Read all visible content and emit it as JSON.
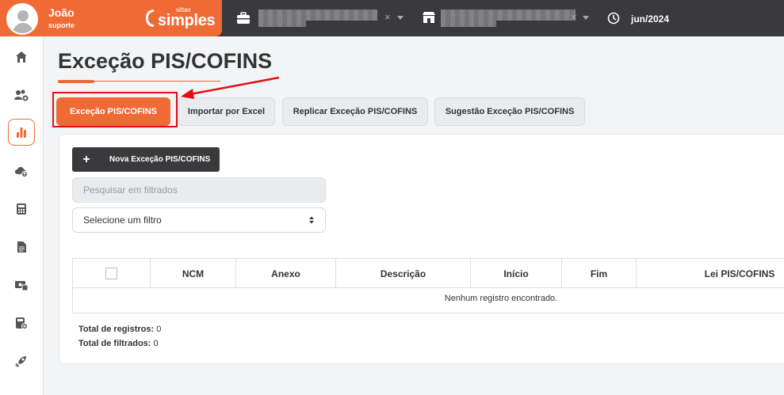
{
  "header": {
    "user_name": "João",
    "user_role": "suporte",
    "logo_small": "sittax",
    "logo_big": "simples",
    "company_icon": "briefcase-icon",
    "store_icon": "store-icon",
    "clock_icon": "clock-icon",
    "period": "jun/2024",
    "colors": {
      "brand": "#f06a35",
      "bar": "#3a3a3c"
    }
  },
  "sidebar": {
    "items": [
      {
        "icon": "home-icon"
      },
      {
        "icon": "users-add-icon"
      },
      {
        "icon": "bar-chart-icon",
        "active": true
      },
      {
        "icon": "cloud-upload-icon"
      },
      {
        "icon": "calculator-icon"
      },
      {
        "icon": "document-icon"
      },
      {
        "icon": "money-icon"
      },
      {
        "icon": "calculator-add-icon"
      },
      {
        "icon": "rocket-icon"
      }
    ]
  },
  "page": {
    "title": "Exceção PIS/COFINS",
    "tabs": [
      {
        "label": "Exceção PIS/COFINS",
        "active": true
      },
      {
        "label": "Importar por Excel"
      },
      {
        "label": "Replicar Exceção PIS/COFINS"
      },
      {
        "label": "Sugestão Exceção PIS/COFINS"
      }
    ],
    "new_button": {
      "plus": "+",
      "label": "Nova Exceção PIS/COFINS"
    },
    "search": {
      "placeholder": "Pesquisar em filtrados"
    },
    "filter_select": {
      "value": "Selecione um filtro"
    },
    "table": {
      "columns": [
        "NCM",
        "Anexo",
        "Descrição",
        "Início",
        "Fim",
        "Lei PIS/COFINS"
      ],
      "empty_message": "Nenhum registro encontrado."
    },
    "totals": {
      "records_label": "Total de registros:",
      "records_value": "0",
      "filtered_label": "Total de filtrados:",
      "filtered_value": "0"
    }
  }
}
